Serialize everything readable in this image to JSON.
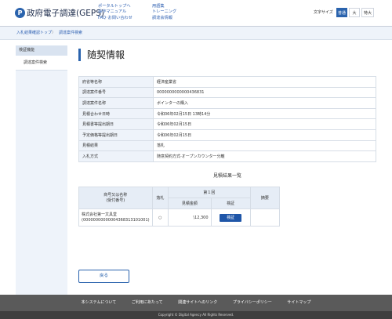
{
  "header": {
    "logo_glyph": "P",
    "site_title": "政府電子調達(GEPS)",
    "links_col1": [
      "ポータルトップへ",
      "操作マニュアル",
      "FAQ･お問い合わせ"
    ],
    "links_col2": [
      "用語集",
      "トレーニング",
      "調達会情報"
    ],
    "font_size_label": "文字サイズ",
    "font_size_options": [
      "普通",
      "大",
      "特大"
    ],
    "font_size_selected": "普通"
  },
  "breadcrumb": {
    "items": [
      "入札結果確認トップ",
      "調達案件検索"
    ],
    "separator": "〉"
  },
  "sidebar": {
    "heading": "検証機能",
    "items": [
      "調達案件検索"
    ]
  },
  "main": {
    "title": "随契情報",
    "info_rows": [
      {
        "label": "府省等名称",
        "value": "経済産業省"
      },
      {
        "label": "調達案件番号",
        "value": "0000000000000436831"
      },
      {
        "label": "調達案件名称",
        "value": "ボインターの購入"
      },
      {
        "label": "見積合わせ日時",
        "value": "令和06年02月15日 13時14分"
      },
      {
        "label": "見積書等提出期日",
        "value": "令和06年02月15日"
      },
      {
        "label": "予定価格等提出期日",
        "value": "令和06年02月15日"
      },
      {
        "label": "見積結果",
        "value": "落札"
      },
      {
        "label": "入札方式",
        "value": "随意契約方式-オープンカウンター分離"
      }
    ],
    "results_title": "見積結果一覧",
    "results_table": {
      "col_name": "商号又は名称\n(受付番号)",
      "col_award": "落札",
      "col_round": "第１回",
      "col_amount": "見積金額",
      "col_detail": "検証",
      "col_note": "摘要",
      "rows": [
        {
          "name": "株式会社第一文具堂",
          "receipt": "(0000000000000436831310100​1)",
          "award": "○",
          "amount": "\\12,300",
          "detail_label": "検証",
          "note": ""
        }
      ]
    },
    "back_label": "戻る"
  },
  "footer": {
    "links": [
      "本システムについて",
      "ご利用にあたって",
      "関連サイトへのリンク",
      "プライバシーポリシー",
      "サイトマップ"
    ],
    "copyright": "Copyright © Digital Agency All Rights Reserved."
  },
  "colors": {
    "accent": "#2a63ad",
    "footer_bg": "#5a5a5a",
    "label_bg": "#eef3fa"
  }
}
